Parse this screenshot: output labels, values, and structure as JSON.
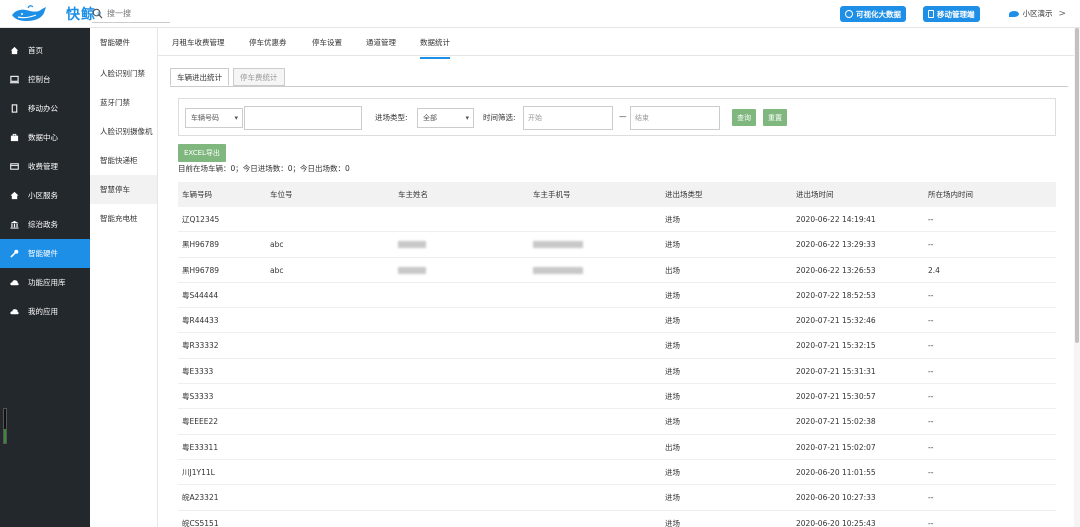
{
  "brand": {
    "name": "快鲸",
    "reg": "®"
  },
  "search": {
    "placeholder": "搜一搜"
  },
  "header": {
    "btn_bigdata": "可视化大数据",
    "btn_mobile": "移动管理端",
    "community": "小区演示",
    "community_chevron": ">"
  },
  "sidebar": {
    "items": [
      {
        "label": "首页",
        "icon": "home-icon"
      },
      {
        "label": "控制台",
        "icon": "monitor-icon"
      },
      {
        "label": "移动办公",
        "icon": "mobile-icon"
      },
      {
        "label": "数据中心",
        "icon": "briefcase-icon"
      },
      {
        "label": "收费管理",
        "icon": "card-icon"
      },
      {
        "label": "小区服务",
        "icon": "house-icon"
      },
      {
        "label": "综治政务",
        "icon": "bank-icon"
      },
      {
        "label": "智能硬件",
        "icon": "wrench-icon",
        "active": true
      },
      {
        "label": "功能应用库",
        "icon": "cloud-upload-icon"
      },
      {
        "label": "我的应用",
        "icon": "cloud-icon"
      }
    ]
  },
  "subsidebar": {
    "title": "智能硬件",
    "items": [
      {
        "label": "人脸识别门禁"
      },
      {
        "label": "蓝牙门禁"
      },
      {
        "label": "人脸识别摄像机"
      },
      {
        "label": "智能快递柜"
      },
      {
        "label": "智慧停车",
        "active": true
      },
      {
        "label": "智能充电桩"
      }
    ]
  },
  "top_tabs": [
    "月租车收费管理",
    "停车优惠券",
    "停车设置",
    "通道管理",
    "数据统计"
  ],
  "active_top_tab": "数据统计",
  "sub_tabs": [
    "车辆进出统计",
    "停车费统计"
  ],
  "filter": {
    "plate_select": "车辆号码",
    "type_label": "进场类型:",
    "type_select": "全部",
    "time_label": "时间筛选:",
    "start_placeholder": "开始",
    "dash": "—",
    "end_placeholder": "结束",
    "query": "查询",
    "reset": "重置"
  },
  "excel_btn": "EXCEL导出",
  "stats_text": "目前在场车辆：0；今日进场数：0；今日出场数：0",
  "table": {
    "headers": [
      "车辆号码",
      "车位号",
      "车主姓名",
      "车主手机号",
      "进出场类型",
      "进出场时间",
      "所在场内时间"
    ],
    "rows": [
      {
        "plate": "辽Q12345",
        "spot": "",
        "name_blur": false,
        "phone_blur": false,
        "type": "进场",
        "time": "2020-06-22 14:19:41",
        "duration": "--"
      },
      {
        "plate": "黑H96789",
        "spot": "abc",
        "name_blur": true,
        "phone_blur": true,
        "type": "进场",
        "time": "2020-06-22 13:29:33",
        "duration": "--"
      },
      {
        "plate": "黑H96789",
        "spot": "abc",
        "name_blur": true,
        "phone_blur": true,
        "type": "出场",
        "time": "2020-06-22 13:26:53",
        "duration": "2.4"
      },
      {
        "plate": "粤S44444",
        "spot": "",
        "name_blur": false,
        "phone_blur": false,
        "type": "进场",
        "time": "2020-07-22 18:52:53",
        "duration": "--"
      },
      {
        "plate": "粤R44433",
        "spot": "",
        "name_blur": false,
        "phone_blur": false,
        "type": "进场",
        "time": "2020-07-21 15:32:46",
        "duration": "--"
      },
      {
        "plate": "粤R33332",
        "spot": "",
        "name_blur": false,
        "phone_blur": false,
        "type": "进场",
        "time": "2020-07-21 15:32:15",
        "duration": "--"
      },
      {
        "plate": "粤E3333",
        "spot": "",
        "name_blur": false,
        "phone_blur": false,
        "type": "进场",
        "time": "2020-07-21 15:31:31",
        "duration": "--"
      },
      {
        "plate": "粤S3333",
        "spot": "",
        "name_blur": false,
        "phone_blur": false,
        "type": "进场",
        "time": "2020-07-21 15:30:57",
        "duration": "--"
      },
      {
        "plate": "粤EEEE22",
        "spot": "",
        "name_blur": false,
        "phone_blur": false,
        "type": "进场",
        "time": "2020-07-21 15:02:38",
        "duration": "--"
      },
      {
        "plate": "粤E33311",
        "spot": "",
        "name_blur": false,
        "phone_blur": false,
        "type": "出场",
        "time": "2020-07-21 15:02:07",
        "duration": "--"
      },
      {
        "plate": "川J1Y11L",
        "spot": "",
        "name_blur": false,
        "phone_blur": false,
        "type": "进场",
        "time": "2020-06-20 11:01:55",
        "duration": "--"
      },
      {
        "plate": "皖A23321",
        "spot": "",
        "name_blur": false,
        "phone_blur": false,
        "type": "进场",
        "time": "2020-06-20 10:27:33",
        "duration": "--"
      },
      {
        "plate": "皖CS5151",
        "spot": "",
        "name_blur": false,
        "phone_blur": false,
        "type": "进场",
        "time": "2020-06-20 10:25:43",
        "duration": "--"
      }
    ]
  },
  "colors": {
    "accent": "#1e8fe6",
    "sidebar_bg": "#23282d",
    "green_btn": "#7fb77e"
  }
}
